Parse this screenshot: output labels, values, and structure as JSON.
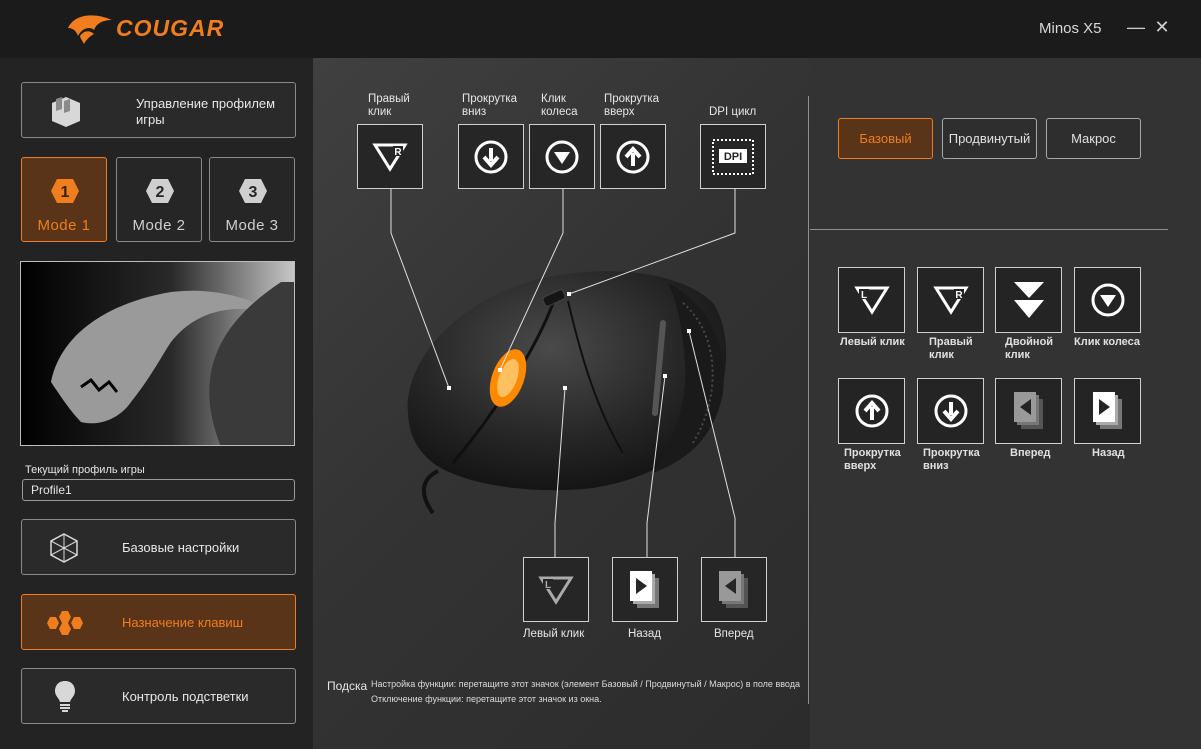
{
  "brand": "COUGAR",
  "device": "Minos X5",
  "window": {
    "minimize": "—",
    "close": "✕"
  },
  "sidebar": {
    "profile_manager": "Управление профилем игры",
    "modes": [
      {
        "number": "1",
        "label": "Mode 1",
        "active": true
      },
      {
        "number": "2",
        "label": "Mode 2",
        "active": false
      },
      {
        "number": "3",
        "label": "Mode 3",
        "active": false
      }
    ],
    "current_profile_label": "Текущий профиль игры",
    "current_profile_value": "Profile1",
    "menu": [
      {
        "label": "Базовые настройки",
        "icon": "cube-icon",
        "active": false
      },
      {
        "label": "Назначение клавиш",
        "icon": "hexagon-cluster-icon",
        "active": true
      },
      {
        "label": "Контроль подстветки",
        "icon": "lightbulb-icon",
        "active": false
      }
    ]
  },
  "mouse_map": {
    "top_keys": [
      {
        "label": "Правый клик",
        "icon": "right-click-icon"
      },
      {
        "label": "Прокрутка вниз",
        "icon": "scroll-down-icon"
      },
      {
        "label": "Клик колеса",
        "icon": "wheel-click-icon"
      },
      {
        "label": "Прокрутка вверх",
        "icon": "scroll-up-icon"
      },
      {
        "label": "DPI цикл",
        "icon": "dpi-cycle-icon"
      }
    ],
    "bottom_keys": [
      {
        "label": "Левый клик",
        "icon": "left-click-icon"
      },
      {
        "label": "Назад",
        "icon": "back-icon"
      },
      {
        "label": "Вперед",
        "icon": "forward-icon"
      }
    ],
    "hint_title": "Подска",
    "hint_line1": "Настройка функции: перетащите этот значок (элемент Базовый / Продвинутый / Макрос) в поле ввода",
    "hint_line2": "Отключение функции: перетащите этот значок из окна."
  },
  "function_panel": {
    "tabs": [
      {
        "label": "Базовый",
        "active": true
      },
      {
        "label": "Продвинутый",
        "active": false
      },
      {
        "label": "Макрос",
        "active": false
      }
    ],
    "functions": [
      {
        "label": "Левый клик",
        "icon": "left-click-icon"
      },
      {
        "label": "Правый клик",
        "icon": "right-click-icon"
      },
      {
        "label": "Двойной клик",
        "icon": "double-click-icon"
      },
      {
        "label": "Клик колеса",
        "icon": "wheel-click-icon"
      },
      {
        "label": "Прокрутка вверх",
        "icon": "scroll-up-icon"
      },
      {
        "label": "Прокрутка вниз",
        "icon": "scroll-down-icon"
      },
      {
        "label": "Вперед",
        "icon": "forward-icon"
      },
      {
        "label": "Назад",
        "icon": "back-icon"
      }
    ]
  },
  "colors": {
    "accent": "#f07d1e",
    "panel": "#232323",
    "wheel_glow": "#ff8a00"
  }
}
